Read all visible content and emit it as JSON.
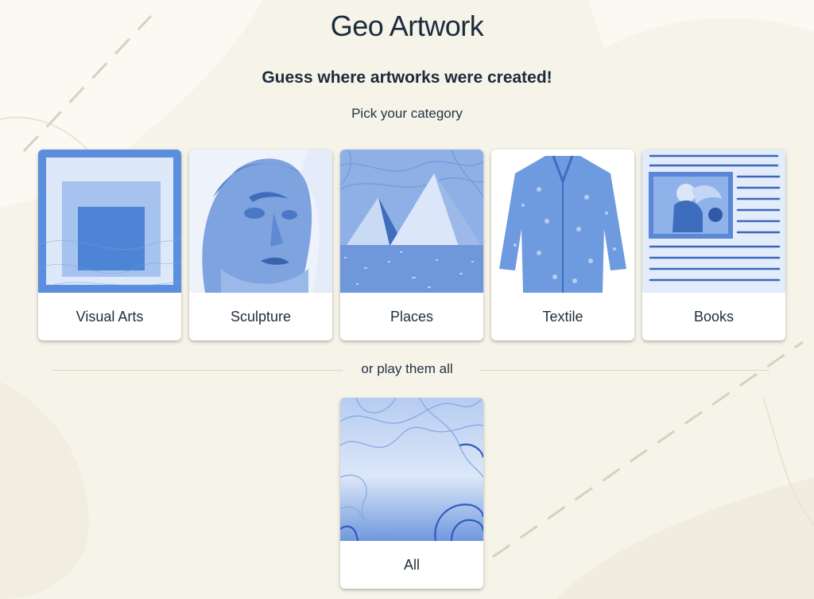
{
  "header": {
    "title": "Geo Artwork",
    "subtitle": "Guess where artworks were created!",
    "prompt": "Pick your category"
  },
  "categories": [
    {
      "label": "Visual Arts",
      "icon": "abstract-squares-thumbnail"
    },
    {
      "label": "Sculpture",
      "icon": "statue-head-thumbnail"
    },
    {
      "label": "Places",
      "icon": "pyramids-thumbnail"
    },
    {
      "label": "Textile",
      "icon": "robe-thumbnail"
    },
    {
      "label": "Books",
      "icon": "manuscript-thumbnail"
    }
  ],
  "divider": {
    "text": "or play them all"
  },
  "all_card": {
    "label": "All",
    "icon": "topographic-map-thumbnail"
  },
  "colors": {
    "card_tint": "#4a7fd4",
    "card_tint_light": "#a9c4ee",
    "background": "#f6f3e8",
    "text": "#1b2b3c"
  }
}
